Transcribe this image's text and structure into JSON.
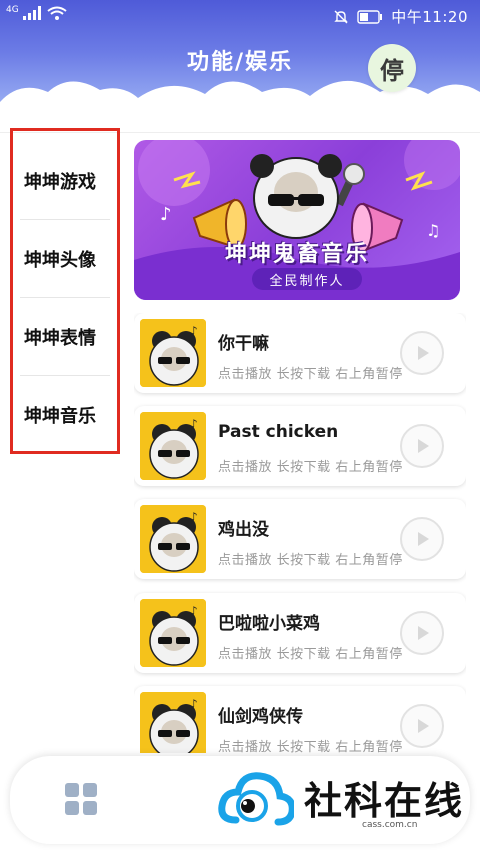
{
  "status_bar": {
    "network": "4G",
    "time": "中午11:20"
  },
  "header": {
    "title": "功能/娱乐",
    "stop_label": "停"
  },
  "sidebar": {
    "items": [
      {
        "label": "坤坤游戏"
      },
      {
        "label": "坤坤头像"
      },
      {
        "label": "坤坤表情"
      },
      {
        "label": "坤坤音乐"
      }
    ],
    "highlight_color": "#e02b20"
  },
  "banner": {
    "title": "坤坤鬼畜音乐",
    "subtitle": "全民制作人"
  },
  "songs": [
    {
      "title": "你干嘛",
      "hint": "点击播放 长按下载 右上角暂停"
    },
    {
      "title": "Past chicken",
      "hint": "点击播放 长按下载 右上角暂停"
    },
    {
      "title": "鸡出没",
      "hint": "点击播放 长按下载 右上角暂停"
    },
    {
      "title": "巴啦啦小菜鸡",
      "hint": "点击播放 长按下载 右上角暂停"
    },
    {
      "title": "仙剑鸡侠传",
      "hint": "点击播放 长按下载 右上角暂停"
    }
  ],
  "bottom_bar": {
    "grid_icon": "grid-icon",
    "watermark_text": "社科在线",
    "watermark_domain": "cass.com.cn"
  },
  "colors": {
    "header_top": "#4f5bd8",
    "banner": "#8b3fd9",
    "thumb_yellow": "#f5c21b",
    "logo_blue": "#1aa3e8"
  }
}
